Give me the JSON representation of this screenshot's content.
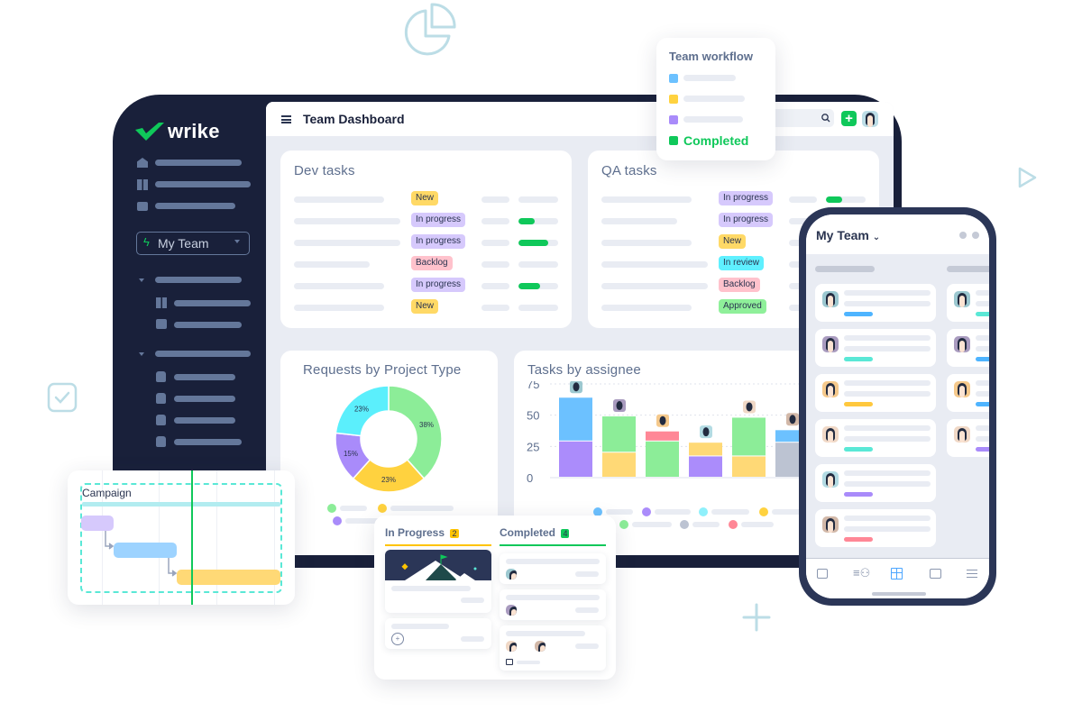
{
  "colors": {
    "accent": "#0fc85a",
    "navy": "#19203a",
    "panel_bg": "#e9ecf3",
    "muted_text": "#5e6f8e",
    "deco": "#bcdde6"
  },
  "decorations": [
    {
      "icon": "pie-chart-icon"
    },
    {
      "icon": "checkbox-icon"
    },
    {
      "icon": "play-icon"
    },
    {
      "icon": "plus-icon"
    }
  ],
  "sidebar": {
    "logo": "wrike",
    "team_selector": {
      "label": "My Team",
      "icon": "bolt-icon"
    },
    "nav_icons": [
      "home-icon",
      "board-icon",
      "calendar-icon"
    ],
    "groups": [
      {
        "sub_icons": [
          "board-icon",
          "calendar-icon"
        ]
      },
      {
        "sub_icons": [
          "folder-icon",
          "folder-icon",
          "folder-icon",
          "folder-icon"
        ]
      }
    ]
  },
  "header": {
    "title": "Team Dashboard",
    "menu_icon": "hamburger-icon",
    "search_icon": "search-icon",
    "add_icon": "plus-icon"
  },
  "workflow_popup": {
    "title": "Team workflow",
    "items": [
      {
        "color": "#6cc1ff"
      },
      {
        "color": "#ffd23f"
      },
      {
        "color": "#a98bfa"
      },
      {
        "color": "#0fc85a",
        "label": "Completed"
      }
    ]
  },
  "dev_tasks": {
    "title": "Dev tasks",
    "rows": [
      {
        "status": "New",
        "color": "#ffd966",
        "progress": null
      },
      {
        "status": "In progress",
        "color": "#d6c9fc",
        "progress": 0.4
      },
      {
        "status": "In progress",
        "color": "#d6c9fc",
        "progress": 0.75
      },
      {
        "status": "Backlog",
        "color": "#ffc2cc",
        "progress": null
      },
      {
        "status": "In progress",
        "color": "#d6c9fc",
        "progress": 0.55
      },
      {
        "status": "New",
        "color": "#ffd966",
        "progress": null
      }
    ]
  },
  "qa_tasks": {
    "title": "QA tasks",
    "rows": [
      {
        "status": "In progress",
        "color": "#d6c9fc",
        "progress": 0.4
      },
      {
        "status": "In progress",
        "color": "#d6c9fc",
        "progress": null
      },
      {
        "status": "New",
        "color": "#ffd966",
        "progress": null
      },
      {
        "status": "In review",
        "color": "#5ff0ff",
        "progress": null
      },
      {
        "status": "Backlog",
        "color": "#ffc2cc",
        "progress": null
      },
      {
        "status": "Approved",
        "color": "#8ff09a",
        "progress": null
      }
    ]
  },
  "chart_data": [
    {
      "type": "pie",
      "title": "Requests by Project Type",
      "slices": [
        {
          "label": "38%",
          "value": 38,
          "color": "#8ced98"
        },
        {
          "label": "23%",
          "value": 23,
          "color": "#ffd23f"
        },
        {
          "label": "15%",
          "value": 15,
          "color": "#a98bfa"
        },
        {
          "label": "23%",
          "value": 23,
          "color": "#5beffc"
        }
      ],
      "legend_colors": [
        "#8ced98",
        "#ffd23f",
        "#a98bfa"
      ]
    },
    {
      "type": "bar",
      "title": "Tasks by assignee",
      "ylim": [
        0,
        75
      ],
      "yticks": [
        "75",
        "50",
        "25",
        "0"
      ],
      "grid": true,
      "stacked": true,
      "series_colors": {
        "blue": "#6cc1ff",
        "purple": "#ab8cfb",
        "green": "#8ced98",
        "yellow": "#ffd976",
        "red": "#ff8796",
        "gray": "#bcc3d2"
      },
      "bars": [
        {
          "segments": [
            {
              "c": "purple",
              "v": 29
            },
            {
              "c": "blue",
              "v": 35
            }
          ]
        },
        {
          "segments": [
            {
              "c": "yellow",
              "v": 20
            },
            {
              "c": "green",
              "v": 29
            }
          ]
        },
        {
          "segments": [
            {
              "c": "green",
              "v": 29
            },
            {
              "c": "red",
              "v": 8
            }
          ]
        },
        {
          "segments": [
            {
              "c": "purple",
              "v": 17
            },
            {
              "c": "yellow",
              "v": 11
            }
          ]
        },
        {
          "segments": [
            {
              "c": "yellow",
              "v": 17
            },
            {
              "c": "green",
              "v": 31
            }
          ]
        },
        {
          "segments": [
            {
              "c": "gray",
              "v": 28
            },
            {
              "c": "blue",
              "v": 10
            }
          ]
        }
      ],
      "legend_colors": [
        "#6cc1ff",
        "#ab8cfb",
        "#8ff0fb",
        "#ffd23f",
        "#8ced98",
        "#bcc3d2",
        "#ff8796"
      ]
    }
  ],
  "gantt": {
    "label": "Campaign",
    "bars": [
      {
        "color": "#d6c9fc"
      },
      {
        "color": "#9dd3ff"
      },
      {
        "color": "#ffd976"
      }
    ]
  },
  "kanban": {
    "columns": [
      {
        "title": "In Progress",
        "count": "2",
        "color": "#ffc400"
      },
      {
        "title": "Completed",
        "count": "4",
        "color": "#0fc85a"
      }
    ]
  },
  "mobile": {
    "title": "My Team",
    "nav_icons": [
      "inbox-icon",
      "team-icon",
      "dashboard-icon",
      "folder-icon",
      "menu-icon"
    ],
    "cards_col1": [
      "#4eb4ff",
      "#5ae8d6",
      "#ffc83d",
      "#5ae8d6",
      "#a98bfa",
      "#ff8796"
    ],
    "cards_col2": [
      "#5ae8d6",
      "#4eb4ff",
      "#4eb4ff",
      "#a98bfa"
    ]
  }
}
